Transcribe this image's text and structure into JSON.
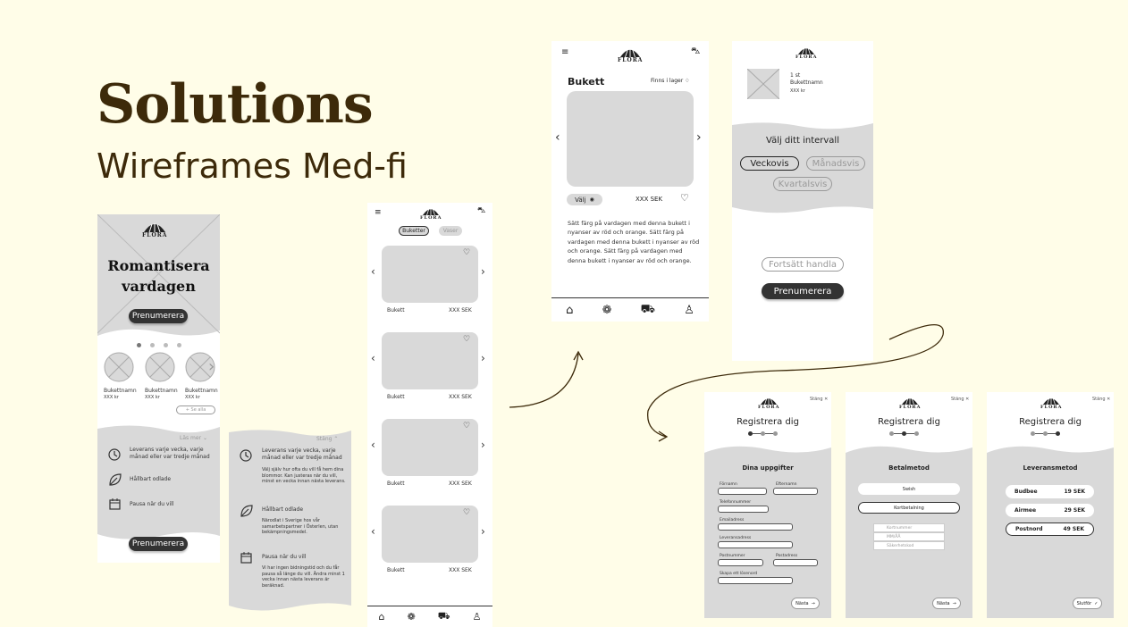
{
  "header": {
    "title": "Solutions",
    "subtitle": "Wireframes Med-fi"
  },
  "logo_text": "FLORA",
  "home": {
    "hero_title_1": "Romantisera",
    "hero_title_2": "vardagen",
    "subscribe": "Prenumerera",
    "bouquets": [
      {
        "name": "Bukettnamn",
        "price": "XXX kr"
      },
      {
        "name": "Bukettnamn",
        "price": "XXX kr"
      },
      {
        "name": "Bukettnamn",
        "price": "XXX kr"
      }
    ],
    "see_all": "Se alla",
    "read_more": "Läs mer",
    "features": [
      "Leverans varje vecka, varje månad eller var tredje månad",
      "Hållbart odlade",
      "Pausa när du vill"
    ],
    "subscribe_bottom": "Prenumerera"
  },
  "expanded": {
    "close": "Stäng",
    "f1_title": "Leverans varje vecka, varje månad eller var tredje månad",
    "f1_text": "Välj själv hur ofta du vill få hem dina blommor. Kan justeras när du vill, minst en vecka innan nästa leverans.",
    "f2_title": "Hållbart odlade",
    "f2_text": "Närodlat i Sverige hos vår samarbetspartner i Österlen, utan bekämpningsmedel.",
    "f3_title": "Pausa när du vill",
    "f3_text": "Vi har ingen bidningstid och du får pausa så länge du vill. Ändra minst 1 vecka innan nästa leverans är beräknad."
  },
  "catalog": {
    "tab_bouquets": "Buketter",
    "tab_vases": "Vaser",
    "items": [
      {
        "name": "Bukett",
        "price": "XXX SEK"
      },
      {
        "name": "Bukett",
        "price": "XXX SEK"
      },
      {
        "name": "Bukett",
        "price": "XXX SEK"
      },
      {
        "name": "Bukett",
        "price": "XXX SEK"
      }
    ]
  },
  "product": {
    "title": "Bukett",
    "stock": "Finns i lager",
    "select": "Välj",
    "price": "XXX SEK",
    "description": "Sätt färg på vardagen med denna bukett i nyanser av röd och orange. Sätt färg på vardagen med denna bukett i nyanser av röd och orange. Sätt färg på vardagen med denna bukett i nyanser av röd och orange."
  },
  "cart": {
    "qty": "1 st",
    "name": "Bukettnamn",
    "price": "XXX kr",
    "interval_title": "Välj ditt intervall",
    "weekly": "Veckovis",
    "monthly": "Månadsvis",
    "quarterly": "Kvartalsvis",
    "continue": "Fortsätt handla",
    "subscribe": "Prenumerera"
  },
  "register": {
    "title": "Registrera dig",
    "close": "Stäng",
    "step1": {
      "heading": "Dina uppgifter",
      "first_name": "Förnamn",
      "last_name": "Efternamn",
      "phone": "Telefonnummer",
      "email": "Emailadress",
      "address": "Leveransadress",
      "zip": "Postnummer",
      "city": "Postadress",
      "password": "Skapa ett lösenord",
      "next": "Nästa"
    },
    "step2": {
      "heading": "Betalmetod",
      "swish": "Swish",
      "card": "Kortbetalning",
      "card_number": "Kortnummer",
      "expiry": "MM/ÅÅ",
      "cvc": "Säkerhetskod",
      "next": "Nästa"
    },
    "step3": {
      "heading": "Leveransmetod",
      "options": [
        {
          "name": "Budbee",
          "price": "19 SEK"
        },
        {
          "name": "Airmee",
          "price": "29 SEK"
        },
        {
          "name": "Postnord",
          "price": "49 SEK"
        }
      ],
      "finish": "Slutför"
    }
  },
  "colors": {
    "background": "#fffde8",
    "title": "#3d2a0a",
    "wire_gray": "#d9d9d9",
    "dark_button": "#333333"
  }
}
